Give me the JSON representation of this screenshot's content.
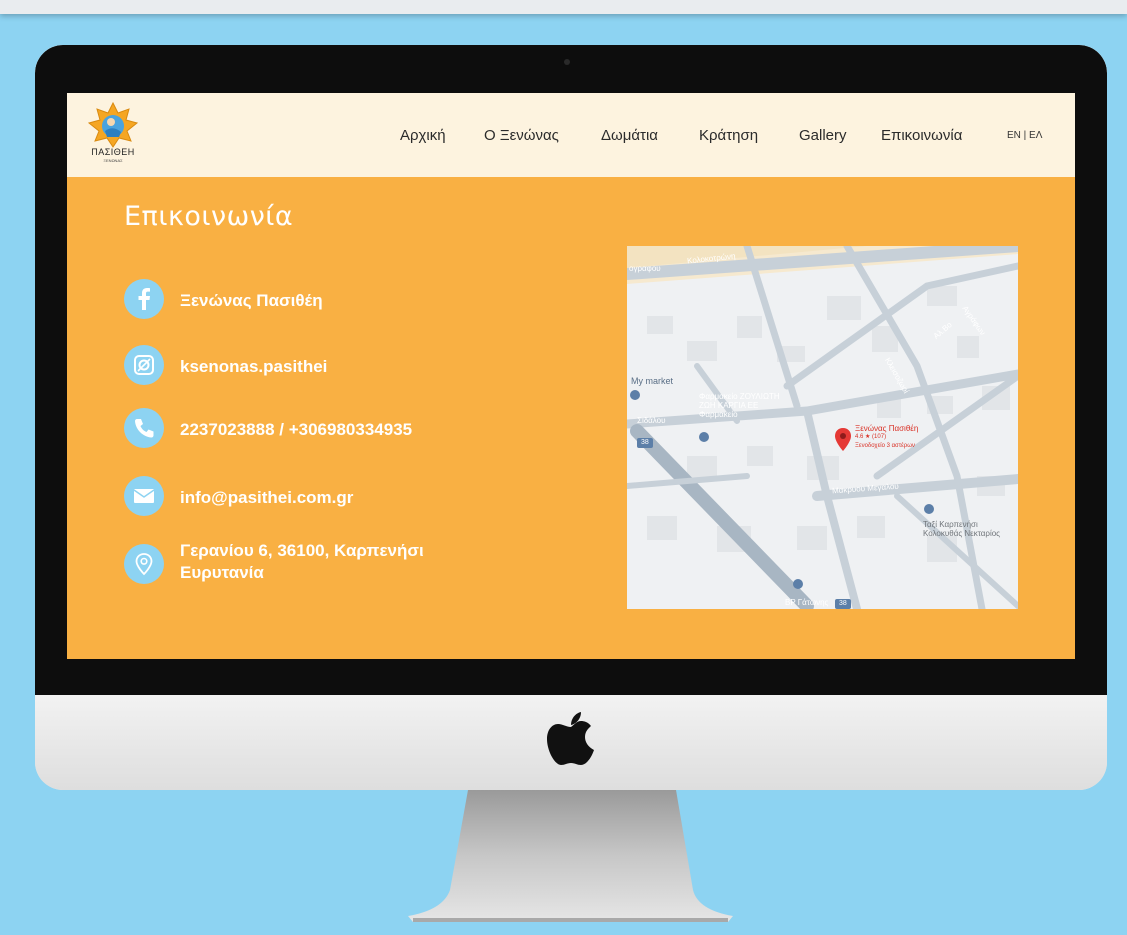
{
  "nav": {
    "items": [
      "Αρχική",
      "Ο Ξενώνας",
      "Δωμάτια",
      "Κράτηση",
      "Gallery",
      "Επικοινωνία"
    ],
    "lang": "EN | ΕΛ"
  },
  "logo": {
    "name": "ΠΑΣΙΘΕΗ",
    "sub": "ΞΕΝΩΝΑΣ"
  },
  "page": {
    "title": "Επικοινωνία"
  },
  "contacts": [
    {
      "icon": "facebook-icon",
      "text": "Ξενώνας Πασιθέη"
    },
    {
      "icon": "instagram-icon",
      "text": "ksenonas.pasithei"
    },
    {
      "icon": "phone-icon",
      "text": "2237023888 / +306980334935"
    },
    {
      "icon": "mail-icon",
      "text": "info@pasithei.com.gr"
    },
    {
      "icon": "location-pin-icon",
      "line1": "Γερανίου 6, 36100, Καρπενήσι",
      "line2": "Ευρυτανία"
    }
  ],
  "map": {
    "street_top": "Κολοκοτρώνη",
    "street_top_left": "ογραφου",
    "market": "My market",
    "pharmacy_line1": "Φαρμακείο ΖΟΥΛΙΩΤΗ",
    "pharmacy_line2": "ΖΩΗ ΚΑΡΓΙΑ ΕΕ",
    "pharmacy_line3": "Φαρμακείο",
    "left_street": "Σιδάλου",
    "place_name": "Ξενώνας Πασιθέη",
    "place_rating": "4.6 ★ (107)",
    "place_type": "Ξενοδοχείο 3 αστέρων",
    "street_mid": "Μακρυου Μεγαλου",
    "street_diag1": "Αλ.Βο",
    "street_diag2": "Αγράφων",
    "street_diag3": "Κλεισοζωρί",
    "taxi_line1": "Ταξί Καρπενήσι",
    "taxi_line2": "Κολοκυθάς Νεκταρίος",
    "bp": "BP Γάτωνης",
    "route_38a": "38",
    "route_38b": "38"
  },
  "colors": {
    "page_bg": "#8dd3f2",
    "site_bg": "#f9b043",
    "header_bg": "#fdf3df",
    "icon_circle": "#8dd3f2",
    "map_pin": "#e53935"
  }
}
